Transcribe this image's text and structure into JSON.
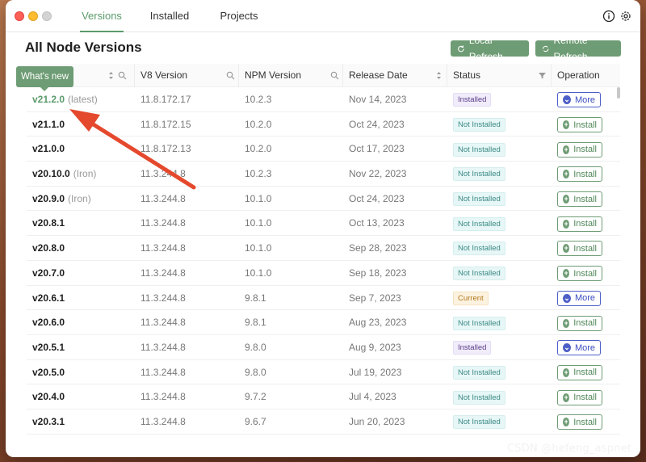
{
  "tabs": [
    "Versions",
    "Installed",
    "Projects"
  ],
  "page_title": "All Node Versions",
  "buttons": {
    "local_refresh": "Local Refresh",
    "remote_refresh": "Remote Refresh"
  },
  "columns": [
    "V8 Version",
    "NPM Version",
    "Release Date",
    "Status",
    "Operation"
  ],
  "tooltip": "What's new",
  "rows": [
    {
      "version": "v21.2.0",
      "tag": "(latest)",
      "v8": "11.8.172.17",
      "npm": "10.2.3",
      "date": "Nov 14, 2023",
      "status": "Installed",
      "op": "More"
    },
    {
      "version": "v21.1.0",
      "tag": "",
      "v8": "11.8.172.15",
      "npm": "10.2.0",
      "date": "Oct 24, 2023",
      "status": "Not Installed",
      "op": "Install"
    },
    {
      "version": "v21.0.0",
      "tag": "",
      "v8": "11.8.172.13",
      "npm": "10.2.0",
      "date": "Oct 17, 2023",
      "status": "Not Installed",
      "op": "Install"
    },
    {
      "version": "v20.10.0",
      "tag": "(Iron)",
      "v8": "11.3.244.8",
      "npm": "10.2.3",
      "date": "Nov 22, 2023",
      "status": "Not Installed",
      "op": "Install"
    },
    {
      "version": "v20.9.0",
      "tag": "(Iron)",
      "v8": "11.3.244.8",
      "npm": "10.1.0",
      "date": "Oct 24, 2023",
      "status": "Not Installed",
      "op": "Install"
    },
    {
      "version": "v20.8.1",
      "tag": "",
      "v8": "11.3.244.8",
      "npm": "10.1.0",
      "date": "Oct 13, 2023",
      "status": "Not Installed",
      "op": "Install"
    },
    {
      "version": "v20.8.0",
      "tag": "",
      "v8": "11.3.244.8",
      "npm": "10.1.0",
      "date": "Sep 28, 2023",
      "status": "Not Installed",
      "op": "Install"
    },
    {
      "version": "v20.7.0",
      "tag": "",
      "v8": "11.3.244.8",
      "npm": "10.1.0",
      "date": "Sep 18, 2023",
      "status": "Not Installed",
      "op": "Install"
    },
    {
      "version": "v20.6.1",
      "tag": "",
      "v8": "11.3.244.8",
      "npm": "9.8.1",
      "date": "Sep 7, 2023",
      "status": "Current",
      "op": "More"
    },
    {
      "version": "v20.6.0",
      "tag": "",
      "v8": "11.3.244.8",
      "npm": "9.8.1",
      "date": "Aug 23, 2023",
      "status": "Not Installed",
      "op": "Install"
    },
    {
      "version": "v20.5.1",
      "tag": "",
      "v8": "11.3.244.8",
      "npm": "9.8.0",
      "date": "Aug 9, 2023",
      "status": "Installed",
      "op": "More"
    },
    {
      "version": "v20.5.0",
      "tag": "",
      "v8": "11.3.244.8",
      "npm": "9.8.0",
      "date": "Jul 19, 2023",
      "status": "Not Installed",
      "op": "Install"
    },
    {
      "version": "v20.4.0",
      "tag": "",
      "v8": "11.3.244.8",
      "npm": "9.7.2",
      "date": "Jul 4, 2023",
      "status": "Not Installed",
      "op": "Install"
    },
    {
      "version": "v20.3.1",
      "tag": "",
      "v8": "11.3.244.8",
      "npm": "9.6.7",
      "date": "Jun 20, 2023",
      "status": "Not Installed",
      "op": "Install"
    }
  ],
  "watermark": "CSDN @hefeng_aspnet",
  "colors": {
    "accent": "#6e9c74",
    "more": "#4d5fc7",
    "arrow": "#e5492d"
  }
}
